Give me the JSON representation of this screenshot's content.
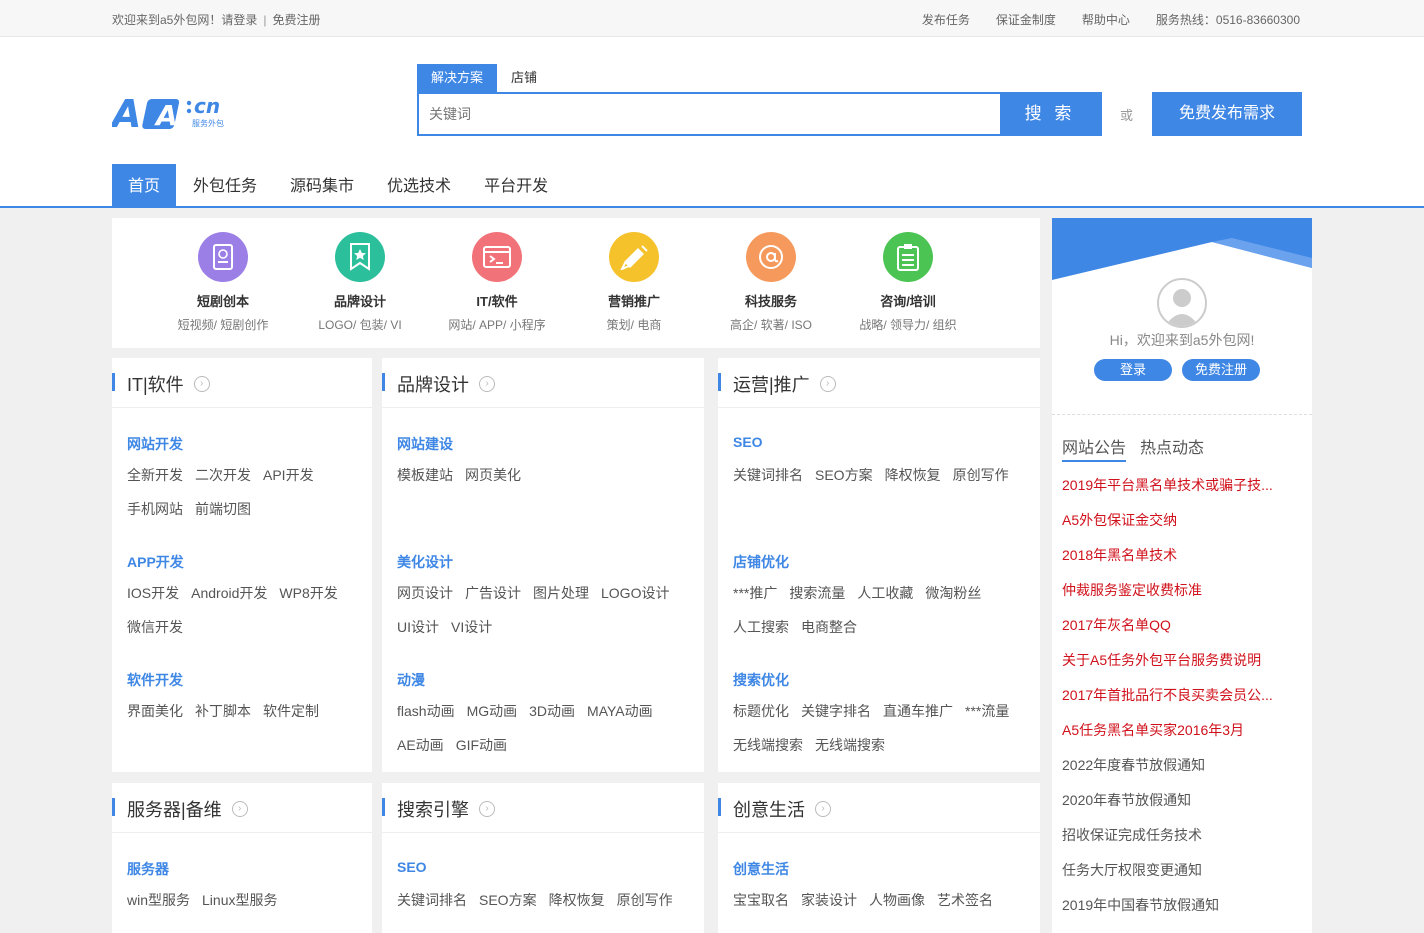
{
  "topbar": {
    "welcome": "欢迎来到a5外包网！请登录",
    "register": "免费注册",
    "links": [
      "发布任务",
      "保证金制度",
      "帮助中心",
      "服务热线：0516-83660300"
    ]
  },
  "logo": {
    "main": "A5",
    "suffix": "cn",
    "sub": "服务外包"
  },
  "search": {
    "tabs": [
      "解决方案",
      "店铺"
    ],
    "placeholder": "关键词",
    "button": "搜 索",
    "or": "或",
    "publish": "免费发布需求"
  },
  "nav": [
    "首页",
    "外包任务",
    "源码集市",
    "优选技术",
    "平台开发"
  ],
  "categories": [
    {
      "name": "短剧创本",
      "sub": "短视频/ 短剧创作",
      "icon": "script-icon",
      "color": "#9b7fe6"
    },
    {
      "name": "品牌设计",
      "sub": "LOGO/ 包装/ VI",
      "icon": "star-badge-icon",
      "color": "#2bbf9c"
    },
    {
      "name": "IT/软件",
      "sub": "网站/ APP/ 小程序",
      "icon": "terminal-icon",
      "color": "#f2727a"
    },
    {
      "name": "营销推广",
      "sub": "策划/ 电商",
      "icon": "megaphone-icon",
      "color": "#f5c22c"
    },
    {
      "name": "科技服务",
      "sub": "高企/ 软著/ ISO",
      "icon": "at-icon",
      "color": "#f59a5c"
    },
    {
      "name": "咨询/培训",
      "sub": "战略/ 领导力/ 组织",
      "icon": "clipboard-icon",
      "color": "#4cc453"
    }
  ],
  "panels": [
    {
      "title": "IT|软件",
      "groups": [
        {
          "title": "网站开发",
          "links": [
            "全新开发",
            "二次开发",
            "API开发",
            "手机网站",
            "前端切图"
          ]
        },
        {
          "title": "APP开发",
          "links": [
            "IOS开发",
            "Android开发",
            "WP8开发",
            "微信开发"
          ]
        },
        {
          "title": "软件开发",
          "links": [
            "界面美化",
            "补丁脚本",
            "软件定制"
          ]
        }
      ]
    },
    {
      "title": "品牌设计",
      "groups": [
        {
          "title": "网站建设",
          "links": [
            "模板建站",
            "网页美化"
          ]
        },
        {
          "title": "美化设计",
          "links": [
            "网页设计",
            "广告设计",
            "图片处理",
            "LOGO设计",
            "UI设计",
            "VI设计"
          ]
        },
        {
          "title": "动漫",
          "links": [
            "flash动画",
            "MG动画",
            "3D动画",
            "MAYA动画",
            "AE动画",
            "GIF动画"
          ]
        }
      ]
    },
    {
      "title": "运营|推广",
      "groups": [
        {
          "title": "SEO",
          "links": [
            "关键词排名",
            "SEO方案",
            "降权恢复",
            "原创写作"
          ]
        },
        {
          "title": "店铺优化",
          "links": [
            "***推广",
            "搜索流量",
            "人工收藏",
            "微淘粉丝",
            "人工搜索",
            "电商整合"
          ]
        },
        {
          "title": "搜索优化",
          "links": [
            "标题优化",
            "关键字排名",
            "直通车推广",
            "***流量",
            "无线端搜索",
            "无线端搜索"
          ]
        }
      ]
    },
    {
      "title": "服务器|备维",
      "groups": [
        {
          "title": "服务器",
          "links": [
            "win型服务",
            "Linux型服务"
          ]
        }
      ]
    },
    {
      "title": "搜索引擎",
      "groups": [
        {
          "title": "SEO",
          "links": [
            "关键词排名",
            "SEO方案",
            "降权恢复",
            "原创写作"
          ]
        }
      ]
    },
    {
      "title": "创意生活",
      "groups": [
        {
          "title": "创意生活",
          "links": [
            "宝宝取名",
            "家装设计",
            "人物画像",
            "艺术签名"
          ]
        }
      ]
    }
  ],
  "sidebar": {
    "welcome": "Hi，欢迎来到a5外包网!",
    "login": "登录",
    "register": "免费注册",
    "tabs": [
      "网站公告",
      "热点动态"
    ],
    "notices": [
      {
        "text": "2019年平台黑名单技术或骗子技...",
        "red": true
      },
      {
        "text": "A5外包保证金交纳",
        "red": true
      },
      {
        "text": "2018年黑名单技术",
        "red": true
      },
      {
        "text": "仲裁服务鉴定收费标准",
        "red": true
      },
      {
        "text": "2017年灰名单QQ",
        "red": true
      },
      {
        "text": "关于A5任务外包平台服务费说明",
        "red": true
      },
      {
        "text": "2017年首批品行不良买卖会员公...",
        "red": true
      },
      {
        "text": "A5任务黑名单买家2016年3月",
        "red": true
      },
      {
        "text": "2022年度春节放假通知",
        "red": false
      },
      {
        "text": "2020年春节放假通知",
        "red": false
      },
      {
        "text": "招收保证完成任务技术",
        "red": false
      },
      {
        "text": "任务大厅权限变更通知",
        "red": false
      },
      {
        "text": "2019年中国春节放假通知",
        "red": false
      }
    ]
  },
  "colors": {
    "accent": "#3f87e5",
    "notice_red": "#d0111b"
  }
}
